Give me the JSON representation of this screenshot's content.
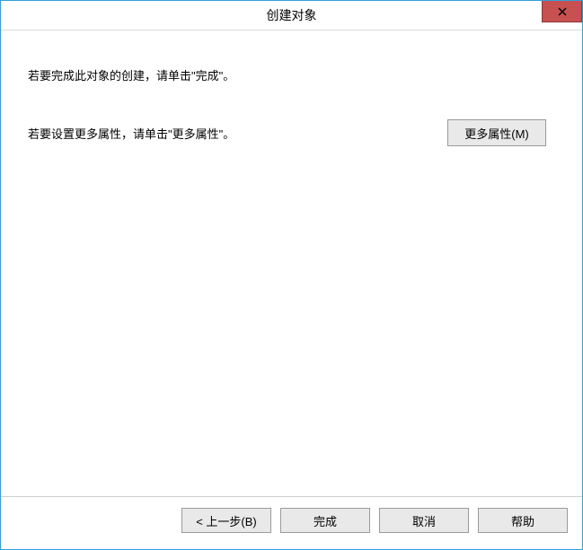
{
  "window": {
    "title": "创建对象"
  },
  "content": {
    "instruction_finish": "若要完成此对象的创建，请单击\"完成\"。",
    "instruction_more": "若要设置更多属性，请单击\"更多属性\"。",
    "more_button_label": "更多属性(M)"
  },
  "footer": {
    "back_label": "< 上一步(B)",
    "finish_label": "完成",
    "cancel_label": "取消",
    "help_label": "帮助"
  }
}
